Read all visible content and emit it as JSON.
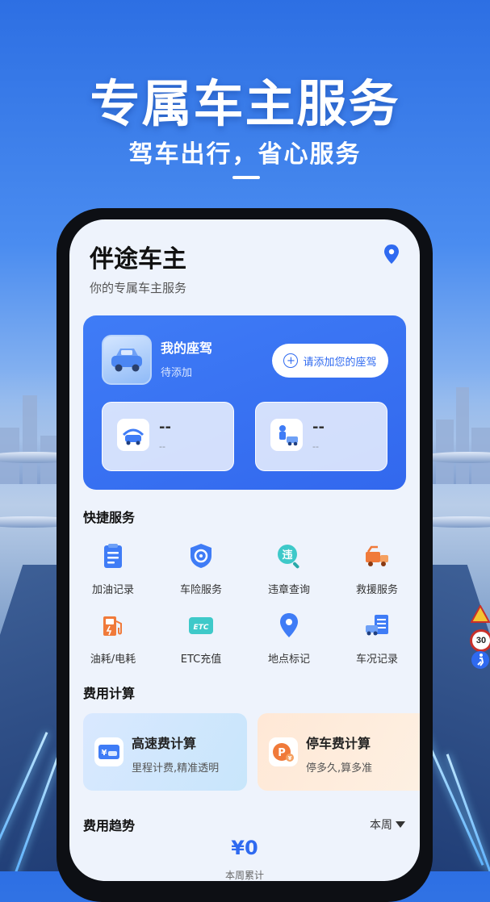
{
  "hero": {
    "title": "专属车主服务",
    "subtitle": "驾车出行，省心服务"
  },
  "app": {
    "title": "伴途车主",
    "subtitle": "你的专属车主服务"
  },
  "car_card": {
    "name": "我的座驾",
    "status": "待添加",
    "add_button": "请添加您的座驾",
    "stats": [
      {
        "value": "--",
        "label": "--",
        "icon": "car-wash-icon"
      },
      {
        "value": "--",
        "label": "--",
        "icon": "car-repair-icon"
      }
    ]
  },
  "quick_services": {
    "title": "快捷服务",
    "items": [
      {
        "label": "加油记录",
        "icon": "fuel-record-icon"
      },
      {
        "label": "车险服务",
        "icon": "insurance-shield-icon"
      },
      {
        "label": "违章查询",
        "icon": "violation-search-icon"
      },
      {
        "label": "救援服务",
        "icon": "tow-truck-icon"
      },
      {
        "label": "油耗/电耗",
        "icon": "fuel-pump-icon"
      },
      {
        "label": "ETC充值",
        "icon": "etc-card-icon"
      },
      {
        "label": "地点标记",
        "icon": "location-pin-icon"
      },
      {
        "label": "车况记录",
        "icon": "vehicle-record-icon"
      }
    ]
  },
  "fee_calc": {
    "title": "费用计算",
    "cards": [
      {
        "title": "高速费计算",
        "desc": "里程计费,精准透明",
        "icon": "highway-fee-icon",
        "accent": "#3f7cf6"
      },
      {
        "title": "停车费计算",
        "desc": "停多久,算多准",
        "icon": "parking-fee-icon",
        "accent": "#f07a3a"
      }
    ]
  },
  "fee_trend": {
    "title": "费用趋势",
    "filter": "本周",
    "value": "¥0",
    "caption": "本周累计"
  },
  "colors": {
    "primary": "#3f7cf6",
    "orange": "#f07a3a"
  }
}
